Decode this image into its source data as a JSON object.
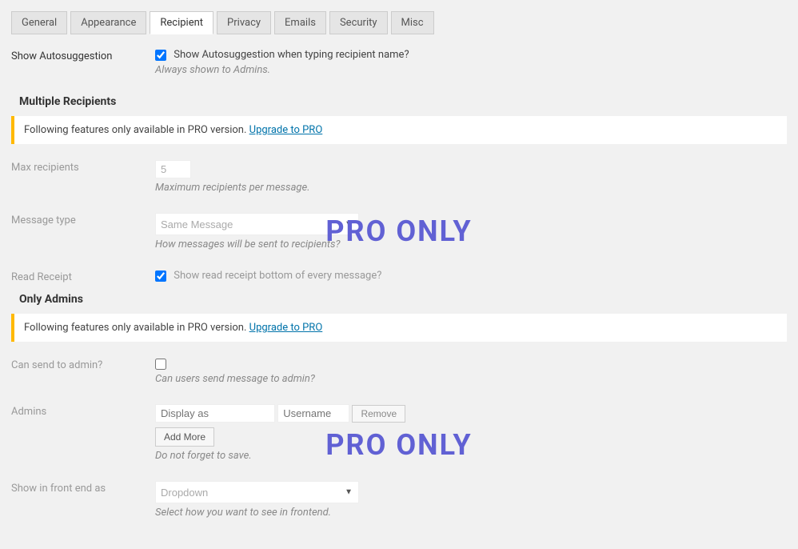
{
  "tabs": {
    "general": "General",
    "appearance": "Appearance",
    "recipient": "Recipient",
    "privacy": "Privacy",
    "emails": "Emails",
    "security": "Security",
    "misc": "Misc"
  },
  "showAutosuggestion": {
    "label": "Show Autosuggestion",
    "checkbox_label": "Show Autosuggestion when typing recipient name?",
    "help": "Always shown to Admins."
  },
  "sections": {
    "multiple": "Multiple Recipients",
    "onlyAdmins": "Only Admins"
  },
  "notice": {
    "text": "Following features only available in PRO version.",
    "link": "Upgrade to PRO"
  },
  "maxRecipients": {
    "label": "Max recipients",
    "value": "5",
    "help": "Maximum recipients per message."
  },
  "messageType": {
    "label": "Message type",
    "value": "Same Message",
    "help": "How messages will be sent to recipients?"
  },
  "readReceipt": {
    "label": "Read Receipt",
    "checkbox_label": "Show read receipt bottom of every message?"
  },
  "canSendToAdmin": {
    "label": "Can send to admin?",
    "help": "Can users send message to admin?"
  },
  "admins": {
    "label": "Admins",
    "display_placeholder": "Display as",
    "username_placeholder": "Username",
    "remove": "Remove",
    "addmore": "Add More",
    "help": "Do not forget to save."
  },
  "showFrontend": {
    "label": "Show in front end as",
    "value": "Dropdown",
    "help": "Select how you want to see in frontend."
  },
  "watermark": "PRO ONLY"
}
